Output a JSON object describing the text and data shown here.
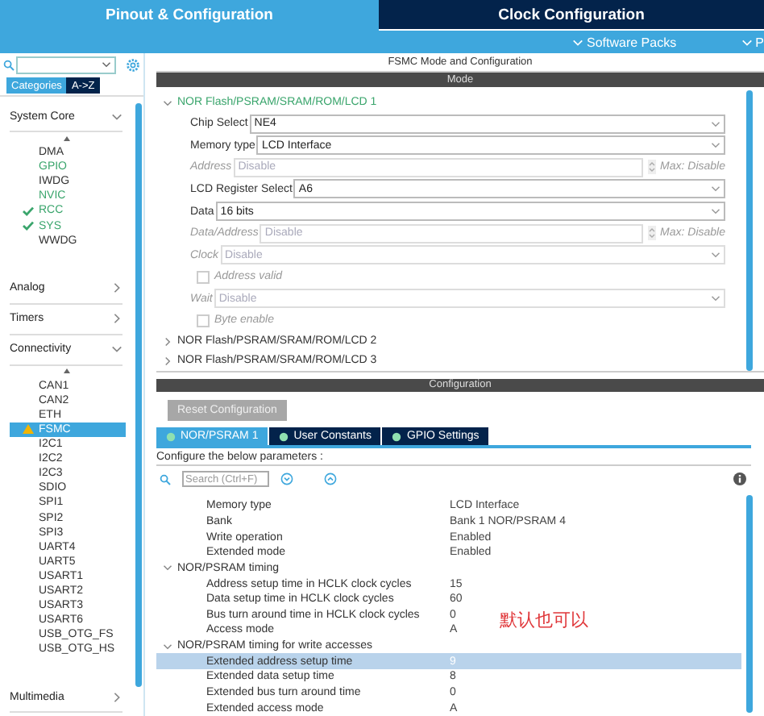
{
  "header": {
    "tabs": [
      {
        "label": "Pinout & Configuration",
        "selected": true
      },
      {
        "label": "Clock Configuration",
        "selected": false
      }
    ],
    "menus": [
      "Software Packs",
      "P"
    ]
  },
  "sidebar": {
    "category_tabs": [
      {
        "label": "Categories",
        "selected": true
      },
      {
        "label": "A->Z",
        "selected": false
      }
    ],
    "groups": [
      {
        "label": "System Core",
        "expanded": true,
        "items": [
          {
            "label": "DMA",
            "configured": false,
            "checked": false,
            "warning": false,
            "selected": false
          },
          {
            "label": "GPIO",
            "configured": true,
            "checked": false,
            "warning": false,
            "selected": false
          },
          {
            "label": "IWDG",
            "configured": false,
            "checked": false,
            "warning": false,
            "selected": false
          },
          {
            "label": "NVIC",
            "configured": true,
            "checked": false,
            "warning": false,
            "selected": false
          },
          {
            "label": "RCC",
            "configured": true,
            "checked": true,
            "warning": false,
            "selected": false
          },
          {
            "label": "SYS",
            "configured": true,
            "checked": true,
            "warning": false,
            "selected": false
          },
          {
            "label": "WWDG",
            "configured": false,
            "checked": false,
            "warning": false,
            "selected": false
          }
        ]
      },
      {
        "label": "Analog",
        "expanded": false
      },
      {
        "label": "Timers",
        "expanded": false
      },
      {
        "label": "Connectivity",
        "expanded": true,
        "items": [
          {
            "label": "CAN1",
            "configured": false,
            "checked": false,
            "warning": false,
            "selected": false
          },
          {
            "label": "CAN2",
            "configured": false,
            "checked": false,
            "warning": false,
            "selected": false
          },
          {
            "label": "ETH",
            "configured": false,
            "checked": false,
            "warning": false,
            "selected": false
          },
          {
            "label": "FSMC",
            "configured": false,
            "checked": false,
            "warning": true,
            "selected": true
          },
          {
            "label": "I2C1",
            "configured": false,
            "checked": false,
            "warning": false,
            "selected": false
          },
          {
            "label": "I2C2",
            "configured": false,
            "checked": false,
            "warning": false,
            "selected": false
          },
          {
            "label": "I2C3",
            "configured": false,
            "checked": false,
            "warning": false,
            "selected": false
          },
          {
            "label": "SDIO",
            "configured": false,
            "checked": false,
            "warning": false,
            "selected": false
          },
          {
            "label": "SPI1",
            "configured": false,
            "checked": false,
            "warning": false,
            "selected": false
          },
          {
            "label": "SPI2",
            "configured": false,
            "checked": false,
            "warning": false,
            "selected": false
          },
          {
            "label": "SPI3",
            "configured": false,
            "checked": false,
            "warning": false,
            "selected": false
          },
          {
            "label": "UART4",
            "configured": false,
            "checked": false,
            "warning": false,
            "selected": false
          },
          {
            "label": "UART5",
            "configured": false,
            "checked": false,
            "warning": false,
            "selected": false
          },
          {
            "label": "USART1",
            "configured": false,
            "checked": false,
            "warning": false,
            "selected": false
          },
          {
            "label": "USART2",
            "configured": false,
            "checked": false,
            "warning": false,
            "selected": false
          },
          {
            "label": "USART3",
            "configured": false,
            "checked": false,
            "warning": false,
            "selected": false
          },
          {
            "label": "USART6",
            "configured": false,
            "checked": false,
            "warning": false,
            "selected": false
          },
          {
            "label": "USB_OTG_FS",
            "configured": false,
            "checked": false,
            "warning": false,
            "selected": false
          },
          {
            "label": "USB_OTG_HS",
            "configured": false,
            "checked": false,
            "warning": false,
            "selected": false
          }
        ]
      },
      {
        "label": "Multimedia",
        "expanded": false
      }
    ]
  },
  "main": {
    "title": "FSMC Mode and Configuration",
    "mode": {
      "title": "Mode",
      "sections": [
        {
          "label": "NOR Flash/PSRAM/SRAM/ROM/LCD 1",
          "expanded": true,
          "fields": [
            {
              "kind": "select",
              "label": "Chip Select",
              "value": "NE4",
              "disabled": false
            },
            {
              "kind": "select",
              "label": "Memory type",
              "value": "LCD Interface",
              "disabled": false
            },
            {
              "kind": "spin",
              "label": "Address",
              "value": "Disable",
              "max": "Max: Disable",
              "disabled": true
            },
            {
              "kind": "select",
              "label": "LCD Register Select",
              "value": "A6",
              "disabled": false
            },
            {
              "kind": "select",
              "label": "Data",
              "value": "16 bits",
              "disabled": false
            },
            {
              "kind": "spin",
              "label": "Data/Address",
              "value": "Disable",
              "max": "Max: Disable",
              "disabled": true
            },
            {
              "kind": "select",
              "label": "Clock",
              "value": "Disable",
              "disabled": true
            },
            {
              "kind": "checkbox",
              "label": "Address valid",
              "checked": false,
              "disabled": true
            },
            {
              "kind": "select",
              "label": "Wait",
              "value": "Disable",
              "disabled": true
            },
            {
              "kind": "checkbox",
              "label": "Byte enable",
              "checked": false,
              "disabled": true
            }
          ]
        },
        {
          "label": "NOR Flash/PSRAM/SRAM/ROM/LCD 2",
          "expanded": false
        },
        {
          "label": "NOR Flash/PSRAM/SRAM/ROM/LCD 3",
          "expanded": false
        }
      ]
    },
    "configuration": {
      "title": "Configuration",
      "reset_button": {
        "label": "Reset Configuration",
        "disabled": true
      },
      "tabs": [
        {
          "label": "NOR/PSRAM 1",
          "selected": true
        },
        {
          "label": "User Constants",
          "selected": false
        },
        {
          "label": "GPIO Settings",
          "selected": false
        }
      ],
      "hint": "Configure the below parameters :",
      "search": {
        "placeholder": "Search (Ctrl+F)"
      },
      "parameters": [
        {
          "kind": "param",
          "label": "Memory type",
          "value": "LCD Interface",
          "selected": false
        },
        {
          "kind": "param",
          "label": "Bank",
          "value": "Bank 1 NOR/PSRAM 4",
          "selected": false
        },
        {
          "kind": "param",
          "label": "Write operation",
          "value": "Enabled",
          "selected": false
        },
        {
          "kind": "param",
          "label": "Extended mode",
          "value": "Enabled",
          "selected": false
        },
        {
          "kind": "group",
          "label": "NOR/PSRAM timing",
          "expanded": true,
          "children": [
            {
              "kind": "param",
              "label": "Address setup time in HCLK clock cycles",
              "value": "15",
              "selected": false
            },
            {
              "kind": "param",
              "label": "Data setup time in HCLK clock cycles",
              "value": "60",
              "selected": false
            },
            {
              "kind": "param",
              "label": "Bus turn around time in HCLK clock cycles",
              "value": "0",
              "selected": false
            },
            {
              "kind": "param",
              "label": "Access mode",
              "value": "A",
              "selected": false
            }
          ]
        },
        {
          "kind": "group",
          "label": "NOR/PSRAM timing for write accesses",
          "expanded": true,
          "children": [
            {
              "kind": "param",
              "label": "Extended address setup time",
              "value": "9",
              "selected": true
            },
            {
              "kind": "param",
              "label": "Extended data setup time",
              "value": "8",
              "selected": false
            },
            {
              "kind": "param",
              "label": "Extended bus turn around time",
              "value": "0",
              "selected": false
            },
            {
              "kind": "param",
              "label": "Extended access mode",
              "value": "A",
              "selected": false
            }
          ]
        }
      ],
      "annotation": "默认也可以"
    }
  }
}
